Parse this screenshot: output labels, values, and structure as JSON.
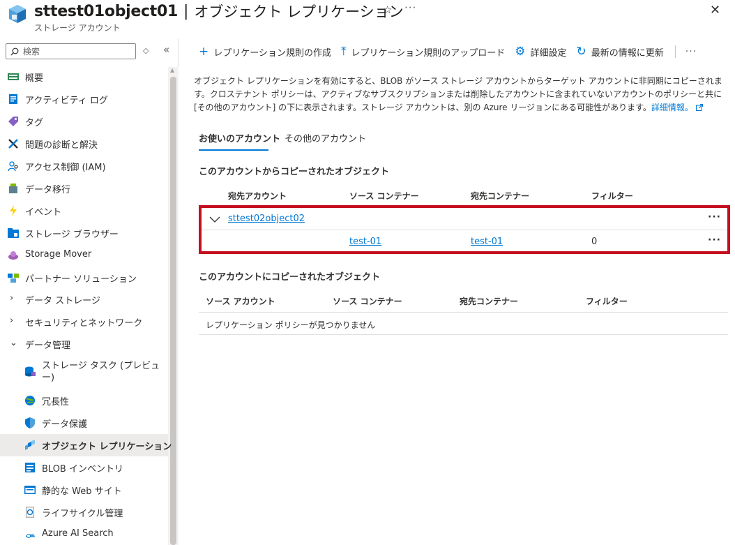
{
  "header": {
    "resource_name": "sttest01object01",
    "separator": "|",
    "page_title": "オブジェクト レプリケーション",
    "subtitle": "ストレージ アカウント"
  },
  "sidebar": {
    "search_placeholder": "検索",
    "items": [
      {
        "label": "概要",
        "icon": "overview-icon"
      },
      {
        "label": "アクティビティ ログ",
        "icon": "activity-log-icon"
      },
      {
        "label": "タグ",
        "icon": "tag-icon"
      },
      {
        "label": "問題の診断と解決",
        "icon": "diagnose-icon"
      },
      {
        "label": "アクセス制御 (IAM)",
        "icon": "iam-icon"
      },
      {
        "label": "データ移行",
        "icon": "data-migration-icon"
      },
      {
        "label": "イベント",
        "icon": "event-icon"
      },
      {
        "label": "ストレージ ブラウザー",
        "icon": "storage-browser-icon"
      },
      {
        "label": "Storage Mover",
        "icon": "storage-mover-icon"
      },
      {
        "label": "パートナー ソリューション",
        "icon": "partner-icon"
      },
      {
        "label": "データ ストレージ",
        "icon": "chevron-right-icon"
      },
      {
        "label": "セキュリティとネットワーク",
        "icon": "chevron-right-icon"
      },
      {
        "label": "データ管理",
        "icon": "chevron-down-icon"
      },
      {
        "label": "ストレージ タスク (プレビュー)",
        "label_line1": "ストレージ タスク (プレビュ",
        "label_line2": "ー)",
        "icon": "storage-task-icon"
      },
      {
        "label": "冗長性",
        "icon": "redundancy-icon"
      },
      {
        "label": "データ保護",
        "icon": "data-protection-icon"
      },
      {
        "label": "オブジェクト レプリケーション",
        "icon": "object-replication-icon"
      },
      {
        "label": "BLOB インベントリ",
        "icon": "blob-inventory-icon"
      },
      {
        "label": "静的な Web サイト",
        "icon": "static-website-icon"
      },
      {
        "label": "ライフサイクル管理",
        "icon": "lifecycle-icon"
      },
      {
        "label": "Azure AI Search",
        "icon": "ai-search-icon"
      }
    ]
  },
  "toolbar": {
    "create_rule": "レプリケーション規則の作成",
    "upload_rule": "レプリケーション規則のアップロード",
    "advanced_settings": "詳細設定",
    "refresh": "最新の情報に更新",
    "more": "···"
  },
  "description": {
    "text": "オブジェクト レプリケーションを有効にすると、BLOB がソース ストレージ アカウントからターゲット アカウントに非同期にコピーされます。クロステナント ポリシーは、アクティブなサブスクリプションまたは削除したアカウントに含まれていないアカウントのポリシーと共に [その他のアカウント] の下に表示されます。ストレージ アカウントは、別の Azure リージョンにある可能性があります。",
    "link": "詳細情報。"
  },
  "tabs": {
    "your_accounts": "お使いのアカウント",
    "other_accounts": "その他のアカウント"
  },
  "copied_from": {
    "title": "このアカウントからコピーされたオブジェクト",
    "headers": {
      "dest_account": "宛先アカウント",
      "source_container": "ソース コンテナー",
      "dest_container": "宛先コンテナー",
      "filter": "フィルター"
    },
    "group": {
      "account": "sttest02object02"
    },
    "row": {
      "source_container": "test-01",
      "dest_container": "test-01",
      "filter": "0"
    },
    "more": "···"
  },
  "copied_to": {
    "title": "このアカウントにコピーされたオブジェクト",
    "headers": {
      "source_account": "ソース アカウント",
      "source_container": "ソース コンテナー",
      "dest_container": "宛先コンテナー",
      "filter": "フィルター"
    },
    "empty": "レプリケーション ポリシーが見つかりません"
  },
  "colors": {
    "accent": "#0078d4",
    "highlight": "#c50f1f"
  }
}
